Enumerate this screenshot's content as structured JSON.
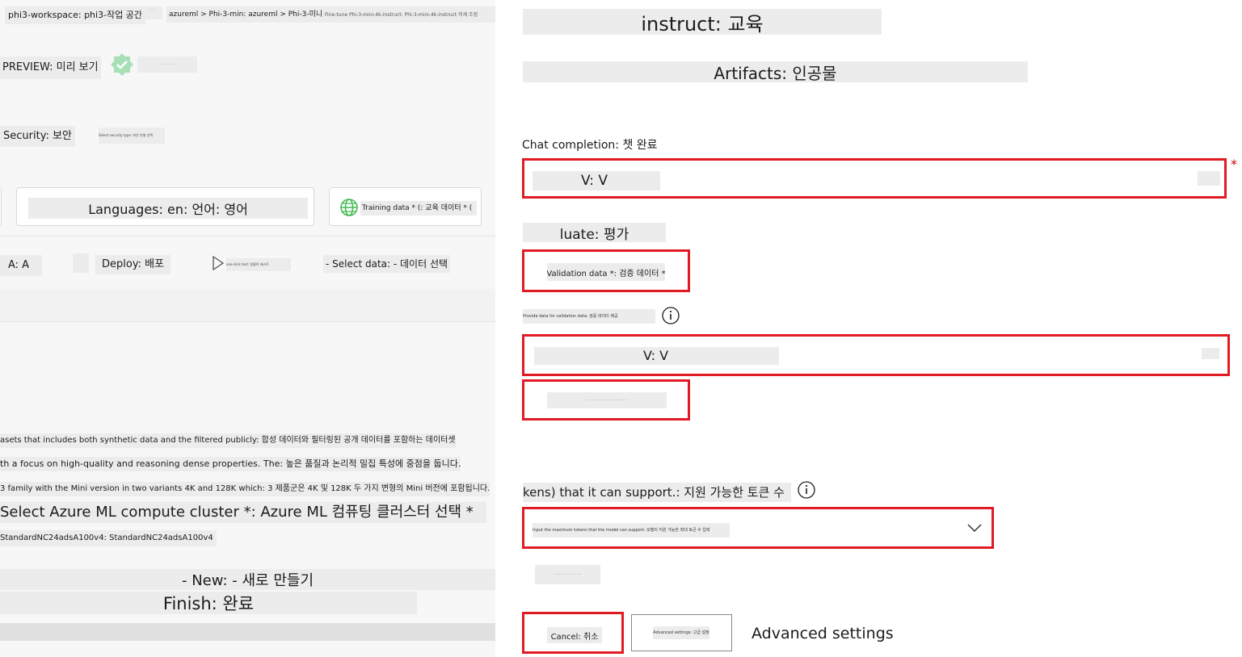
{
  "left": {
    "breadcrumb": {
      "workspace": "phi3-workspace: phi3-작업 공간",
      "separator_icon": "chevron-icon",
      "path_a": "azureml > Phi-3-min: azureml > Phi-3-미니",
      "path_b": "Fine-tune Phi-3-mini-4k-instruct: Phi-3-mini-4k-instruct 미세 조정",
      "small_a": "· · ·",
      "small_b": "· · · · · · · ·"
    },
    "preview_label": "PREVIEW: 미리 보기",
    "preview_icon": "verified-badge-icon",
    "security_label": "Security: 보안",
    "security_note": "Select security type: 보안 유형 선택",
    "languages_label": "Languages: en: 언어: 영어",
    "training_data_label": "Training data * (: 교육 데이터 * (",
    "globe_icon": "globe-icon",
    "steps": {
      "a": "A: A",
      "deploy": "Deploy: 배포",
      "play_note": "one-click test: 원클릭 테스트",
      "select_data": "- Select data: - 데이터 선택"
    },
    "desc_line1": "asets that includes both synthetic data and the filtered publicly: 합성 데이터와 필터링된 공개 데이터를 포함하는 데이터셋",
    "desc_line2": "th a focus on high-quality and reasoning dense properties. The: 높은 품질과 논리적 밀집 특성에 중점을 둡니다.",
    "desc_line3": "3 family with the Mini version in two variants 4K and 128K which: 3 제품군은 4K 및 128K 두 가지 변형의 Mini 버전에 포함됩니다.",
    "compute_title": "Select Azure ML compute cluster *: Azure ML 컴퓨팅 클러스터 선택 *",
    "compute_value": "StandardNC24adsA100v4: StandardNC24adsA100v4",
    "new_label": "- New: - 새로 만들기",
    "finish_label": "Finish: 완료"
  },
  "right": {
    "instruct_title": "instruct: 교육",
    "artifacts_title": "Artifacts: 인공물",
    "chat_completion_label": "Chat completion: 챗 완료",
    "required_star": "*",
    "field1_value": "V: V",
    "evaluate_label": "luate: 평가",
    "validation_data_label": "Validation data *: 검증 데이터 *",
    "validation_note": "Provide data for validation data: 검증 데이터 제공",
    "info_icon": "info-icon",
    "field2_value": "V: V",
    "field2_sub": "· · · · · · · · · · · · · · · ·",
    "tokens_label": "kens) that it can support.: 지원 가능한 토큰 수",
    "dropdown_value": "Input the maximum tokens that the model can support: 모델이 지원 가능한 최대 토큰 수 입력",
    "chevron_icon": "chevron-down-icon",
    "small_caption": "· · · · · · · · · · ·",
    "cancel_label": "Cancel: 취소",
    "advanced_button_label": "Advanced settings: 고급 설정",
    "advanced_settings_text": "Advanced settings"
  },
  "colors": {
    "highlight_red": "#e01b24",
    "left_bg": "#f7f7f7",
    "chip_bg": "#ececec",
    "badge_green": "#3fb950"
  }
}
